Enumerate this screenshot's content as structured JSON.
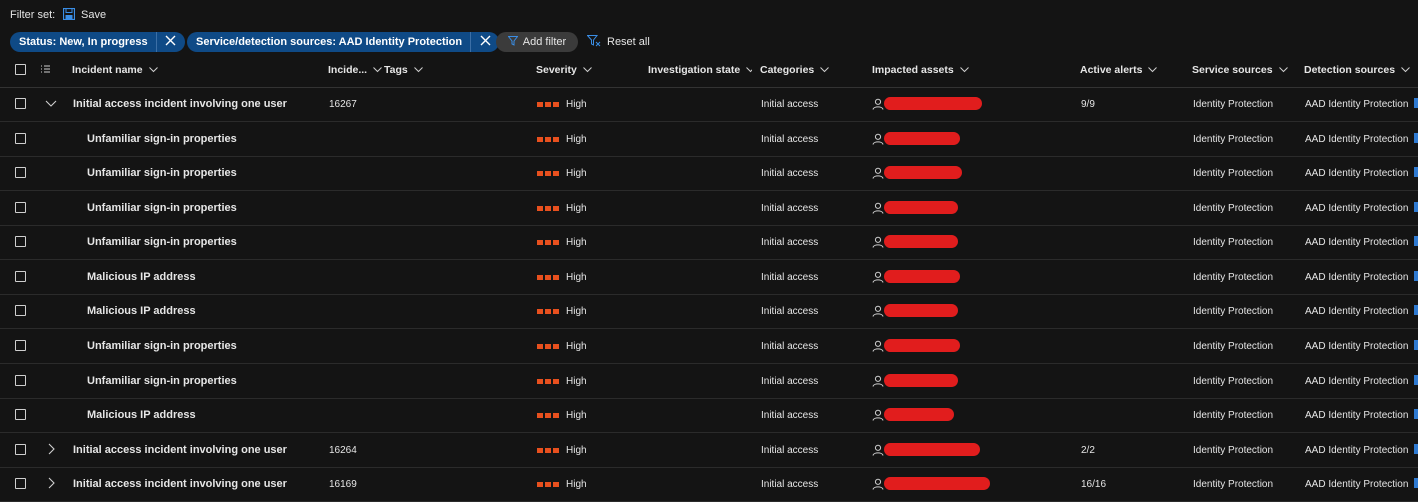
{
  "toolbar": {
    "filter_set_label": "Filter set:",
    "save_label": "Save",
    "save_icon": "floppy-disk-icon"
  },
  "filters": {
    "chips": [
      {
        "label": "Status: New, In progress"
      },
      {
        "label": "Service/detection sources: AAD Identity Protection"
      }
    ],
    "add_filter_label": "Add filter",
    "reset_all_label": "Reset all",
    "chip_color": "#0f4a86"
  },
  "table": {
    "columns": {
      "incident_name": "Incident name",
      "incident_id": "Incide...",
      "tags": "Tags",
      "severity": "Severity",
      "investigation_state": "Investigation state",
      "categories": "Categories",
      "impacted_assets": "Impacted assets",
      "active_alerts": "Active alerts",
      "service_sources": "Service sources",
      "detection_sources": "Detection sources"
    },
    "severity_color": "#e8501e",
    "redaction_color": "#e11d1d",
    "rows": [
      {
        "type": "incident",
        "expanded": true,
        "name": "Initial access incident involving one user",
        "id": "16267",
        "severity": "High",
        "category": "Initial access",
        "alerts": "9/9",
        "service": "Identity Protection",
        "detection": "AAD Identity Protection"
      },
      {
        "type": "alert",
        "name": "Unfamiliar sign-in properties",
        "id": "",
        "severity": "High",
        "category": "Initial access",
        "alerts": "",
        "service": "Identity Protection",
        "detection": "AAD Identity Protection"
      },
      {
        "type": "alert",
        "name": "Unfamiliar sign-in properties",
        "id": "",
        "severity": "High",
        "category": "Initial access",
        "alerts": "",
        "service": "Identity Protection",
        "detection": "AAD Identity Protection"
      },
      {
        "type": "alert",
        "name": "Unfamiliar sign-in properties",
        "id": "",
        "severity": "High",
        "category": "Initial access",
        "alerts": "",
        "service": "Identity Protection",
        "detection": "AAD Identity Protection"
      },
      {
        "type": "alert",
        "name": "Unfamiliar sign-in properties",
        "id": "",
        "severity": "High",
        "category": "Initial access",
        "alerts": "",
        "service": "Identity Protection",
        "detection": "AAD Identity Protection"
      },
      {
        "type": "alert",
        "name": "Malicious IP address",
        "id": "",
        "severity": "High",
        "category": "Initial access",
        "alerts": "",
        "service": "Identity Protection",
        "detection": "AAD Identity Protection"
      },
      {
        "type": "alert",
        "name": "Malicious IP address",
        "id": "",
        "severity": "High",
        "category": "Initial access",
        "alerts": "",
        "service": "Identity Protection",
        "detection": "AAD Identity Protection"
      },
      {
        "type": "alert",
        "name": "Unfamiliar sign-in properties",
        "id": "",
        "severity": "High",
        "category": "Initial access",
        "alerts": "",
        "service": "Identity Protection",
        "detection": "AAD Identity Protection"
      },
      {
        "type": "alert",
        "name": "Unfamiliar sign-in properties",
        "id": "",
        "severity": "High",
        "category": "Initial access",
        "alerts": "",
        "service": "Identity Protection",
        "detection": "AAD Identity Protection"
      },
      {
        "type": "alert",
        "name": "Malicious IP address",
        "id": "",
        "severity": "High",
        "category": "Initial access",
        "alerts": "",
        "service": "Identity Protection",
        "detection": "AAD Identity Protection"
      },
      {
        "type": "incident",
        "expanded": false,
        "name": "Initial access incident involving one user",
        "id": "16264",
        "severity": "High",
        "category": "Initial access",
        "alerts": "2/2",
        "service": "Identity Protection",
        "detection": "AAD Identity Protection"
      },
      {
        "type": "incident",
        "expanded": false,
        "name": "Initial access incident involving one user",
        "id": "16169",
        "severity": "High",
        "category": "Initial access",
        "alerts": "16/16",
        "service": "Identity Protection",
        "detection": "AAD Identity Protection"
      }
    ]
  }
}
